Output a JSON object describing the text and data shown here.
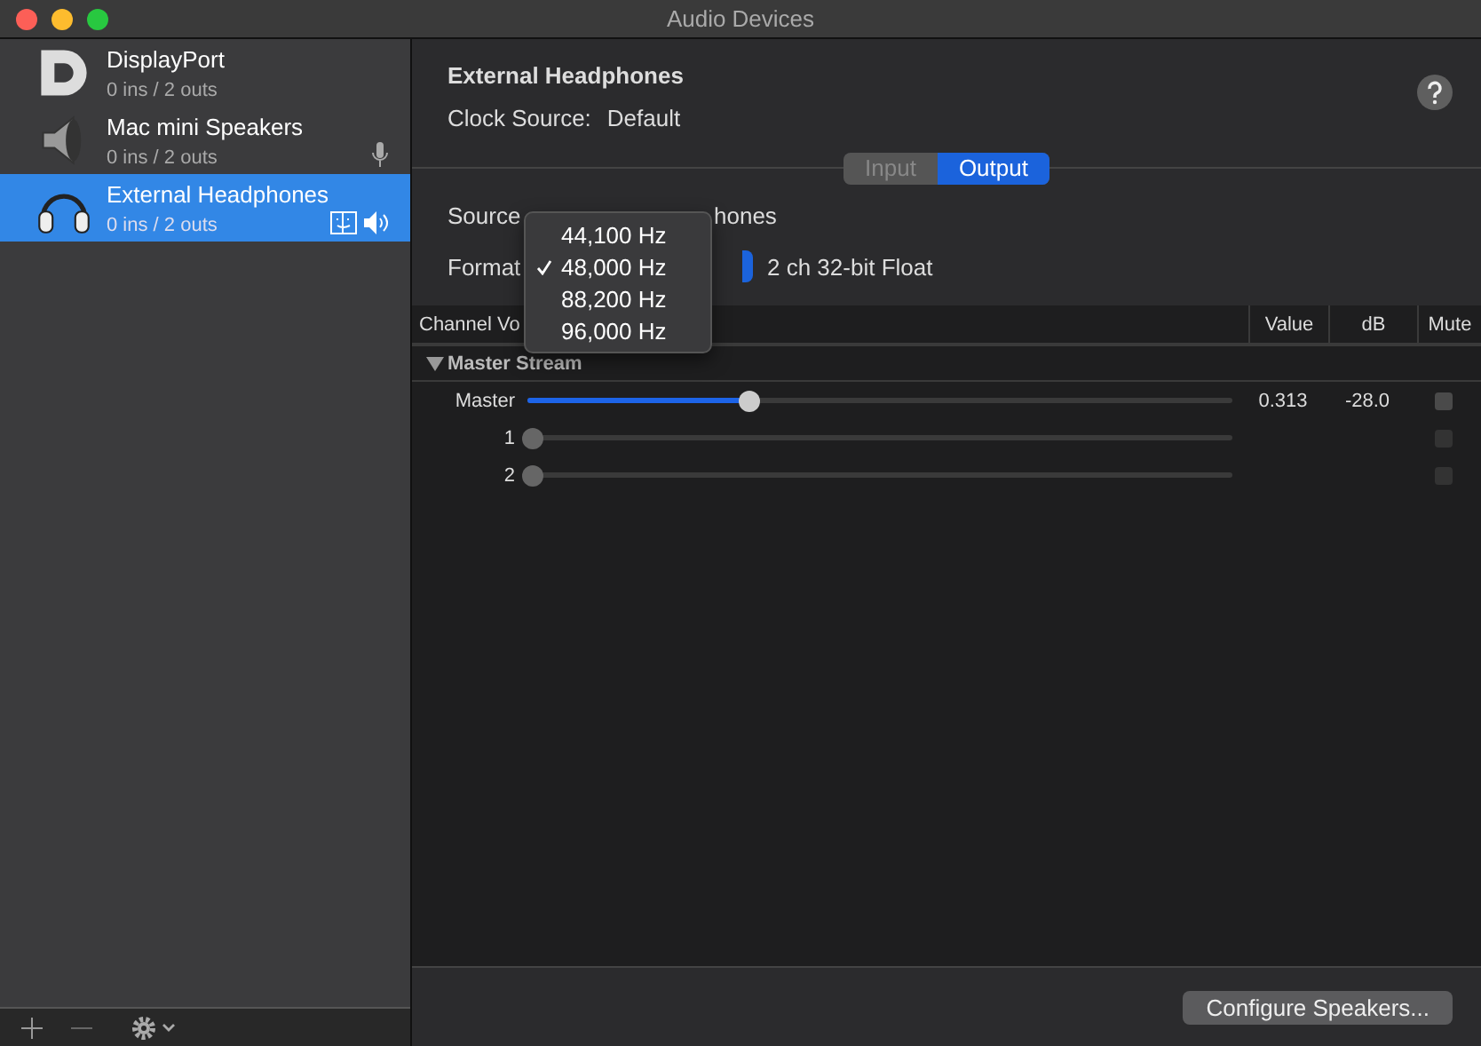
{
  "window": {
    "title": "Audio Devices"
  },
  "devices": [
    {
      "name": "DisplayPort",
      "io": "0 ins / 2 outs",
      "kind": "displayport",
      "selected": false,
      "input_default": false,
      "output_default": false,
      "system_output": false
    },
    {
      "name": "Mac mini Speakers",
      "io": "0 ins / 2 outs",
      "kind": "speaker",
      "selected": false,
      "input_default": true,
      "output_default": false,
      "system_output": false
    },
    {
      "name": "External Headphones",
      "io": "0 ins / 2 outs",
      "kind": "headphones",
      "selected": true,
      "input_default": false,
      "output_default": true,
      "system_output": true
    }
  ],
  "detail": {
    "title": "External Headphones",
    "clock_label": "Clock Source:",
    "clock_value": "Default"
  },
  "tabs": [
    {
      "label": "Input",
      "selected": false
    },
    {
      "label": "Output",
      "selected": true
    }
  ],
  "source": {
    "label": "Source",
    "value_visible": "hones"
  },
  "format": {
    "label": "Format",
    "value": "2 ch 32-bit Float"
  },
  "rate_menu": [
    {
      "label": "44,100 Hz",
      "checked": false
    },
    {
      "label": "48,000 Hz",
      "checked": true
    },
    {
      "label": "88,200 Hz",
      "checked": false
    },
    {
      "label": "96,000 Hz",
      "checked": false
    }
  ],
  "table": {
    "columns": [
      "Channel Vo",
      "Value",
      "dB",
      "Mute"
    ],
    "group": {
      "label": "Master Stream",
      "expanded": true
    },
    "rows": [
      {
        "name": "Master",
        "level": 0.313,
        "value": "0.313",
        "db": "-28.0",
        "muted": false,
        "enabled": true
      },
      {
        "name": "1",
        "level": 0,
        "muted": false,
        "enabled": false
      },
      {
        "name": "2",
        "level": 0,
        "muted": false,
        "enabled": false
      }
    ]
  },
  "configure_button": "Configure Speakers..."
}
